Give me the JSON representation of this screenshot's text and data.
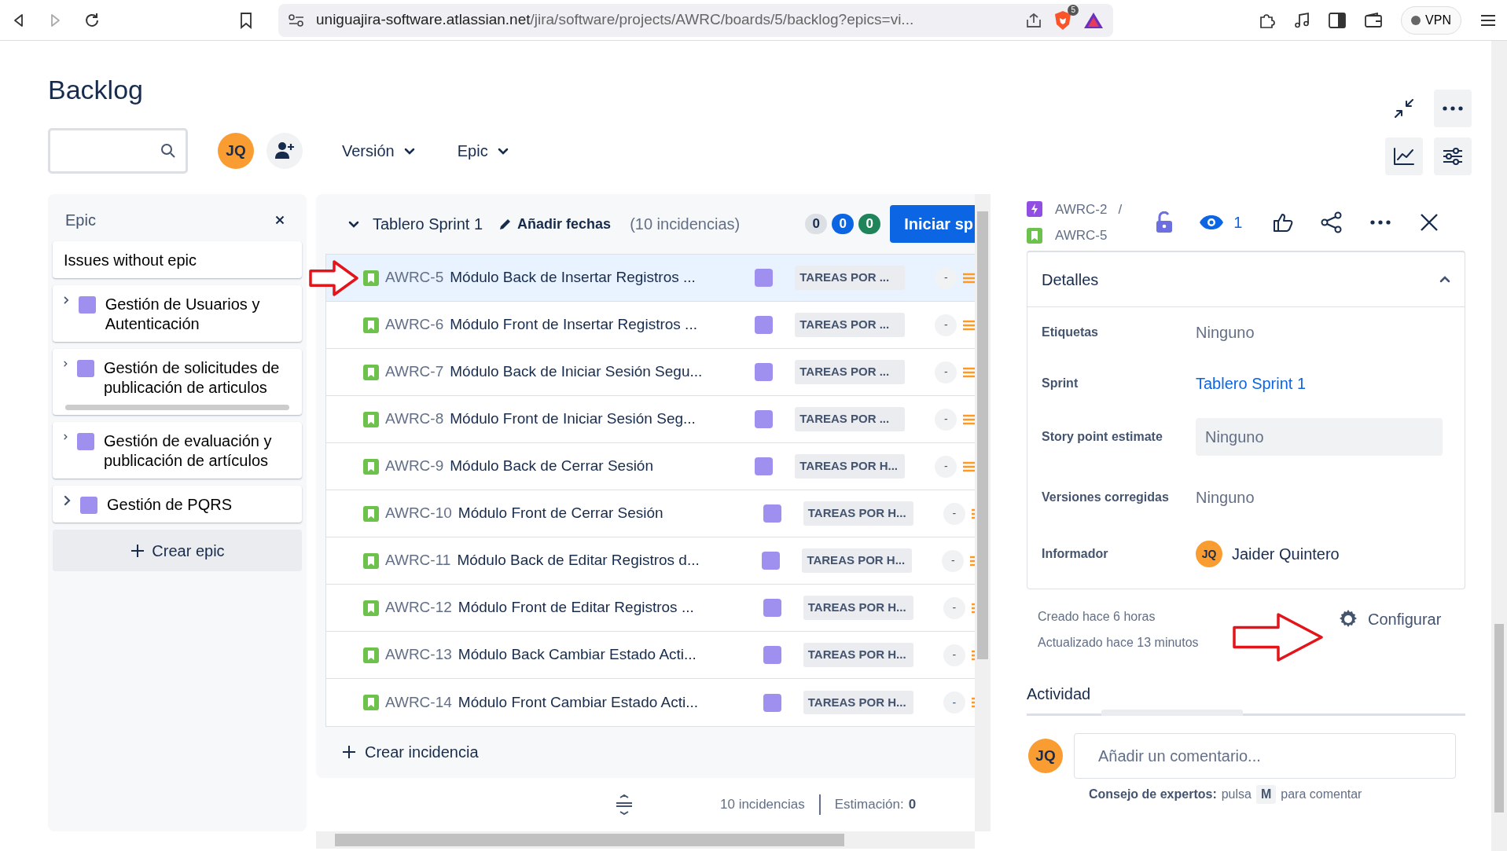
{
  "browser": {
    "host": "uniguajira-software.atlassian.net",
    "path": "/jira/software/projects/AWRC/boards/5/backlog?epics=vi...",
    "shield_badge": "5",
    "vpn": "VPN"
  },
  "header": {
    "title": "Backlog",
    "avatar": "JQ",
    "filters": [
      "Versión",
      "Epic"
    ]
  },
  "epic_panel": {
    "title": "Epic",
    "items": [
      {
        "kind": "plain",
        "label": "Issues without epic",
        "has_scrollbar": false
      },
      {
        "kind": "epic",
        "label": "Gestión de Usuarios y Autenticación",
        "color": "#9f8fef",
        "has_scrollbar": false
      },
      {
        "kind": "epic",
        "label": "Gestión de solicitudes de publicación de articulos",
        "color": "#9f8fef",
        "has_scrollbar": true
      },
      {
        "kind": "epic",
        "label": "Gestión de evaluación y publicación de artículos",
        "color": "#9f8fef",
        "has_scrollbar": false
      },
      {
        "kind": "epic",
        "label": "Gestión de PQRS",
        "color": "#9f8fef",
        "has_scrollbar": false
      }
    ],
    "create": "Crear epic"
  },
  "sprint": {
    "name": "Tablero Sprint 1",
    "expanded": true,
    "add_dates": "Añadir fechas",
    "count": "(10 incidencias)",
    "counters": [
      {
        "value": "0",
        "color": "#dcdfe4"
      },
      {
        "value": "0",
        "color": "#0c66e4"
      },
      {
        "value": "0",
        "color": "#1f845a"
      }
    ],
    "start_button": "Iniciar sp",
    "issues": [
      {
        "key": "AWRC-5",
        "summary": "Módulo Back de Insertar Registros ...",
        "color": "#9f8fef",
        "status": "TAREAS POR ...",
        "estimate": "-",
        "selected": true
      },
      {
        "key": "AWRC-6",
        "summary": "Módulo Front de Insertar Registros ...",
        "color": "#9f8fef",
        "status": "TAREAS POR ...",
        "estimate": "-",
        "selected": false
      },
      {
        "key": "AWRC-7",
        "summary": "Módulo Back de Iniciar Sesión Segu...",
        "color": "#9f8fef",
        "status": "TAREAS POR ...",
        "estimate": "-",
        "selected": false
      },
      {
        "key": "AWRC-8",
        "summary": "Módulo Front de Iniciar Sesión Seg...",
        "color": "#9f8fef",
        "status": "TAREAS POR ...",
        "estimate": "-",
        "selected": false
      },
      {
        "key": "AWRC-9",
        "summary": "Módulo Back de Cerrar Sesión",
        "color": "#9f8fef",
        "status": "TAREAS POR H...",
        "estimate": "-",
        "selected": false
      },
      {
        "key": "AWRC-10",
        "summary": "Módulo Front de Cerrar Sesión",
        "color": "#9f8fef",
        "status": "TAREAS POR H...",
        "estimate": "-",
        "selected": false
      },
      {
        "key": "AWRC-11",
        "summary": "Módulo Back de Editar Registros d...",
        "color": "#9f8fef",
        "status": "TAREAS POR H...",
        "estimate": "-",
        "selected": false
      },
      {
        "key": "AWRC-12",
        "summary": "Módulo Front de Editar Registros ...",
        "color": "#9f8fef",
        "status": "TAREAS POR H...",
        "estimate": "-",
        "selected": false
      },
      {
        "key": "AWRC-13",
        "summary": "Módulo Back Cambiar Estado Acti...",
        "color": "#9f8fef",
        "status": "TAREAS POR H...",
        "estimate": "-",
        "selected": false
      },
      {
        "key": "AWRC-14",
        "summary": "Módulo Front Cambiar Estado Acti...",
        "color": "#9f8fef",
        "status": "TAREAS POR H...",
        "estimate": "-",
        "selected": false
      }
    ],
    "create": "Crear incidencia",
    "footer": {
      "count": "10 incidencias",
      "estimate_label": "Estimación:",
      "estimate_value": "0"
    }
  },
  "detail": {
    "breadcrumb": [
      "AWRC-2",
      "AWRC-5"
    ],
    "breadcrumb_separator": "/",
    "watchers": "1",
    "section": "Detalles",
    "expanded": true,
    "fields": [
      {
        "kind": "text",
        "label": "Etiquetas",
        "value": "Ninguno"
      },
      {
        "kind": "link",
        "label": "Sprint",
        "value": "Tablero Sprint 1"
      },
      {
        "kind": "input",
        "label": "Story point estimate",
        "value": "Ninguno"
      },
      {
        "kind": "text",
        "label": "Versiones corregidas",
        "value": "Ninguno"
      },
      {
        "kind": "user",
        "label": "Informador",
        "value": "Jaider Quintero",
        "avatar": "JQ"
      }
    ],
    "created": "Creado hace 6 horas",
    "updated": "Actualizado hace 13 minutos",
    "configure": "Configurar",
    "activity": "Actividad",
    "avatar": "JQ",
    "comment_placeholder": "Añadir un comentario...",
    "tip_label": "Consejo de expertos:",
    "tip_text": "pulsa",
    "tip_key": "M",
    "tip_end": "para comentar"
  }
}
